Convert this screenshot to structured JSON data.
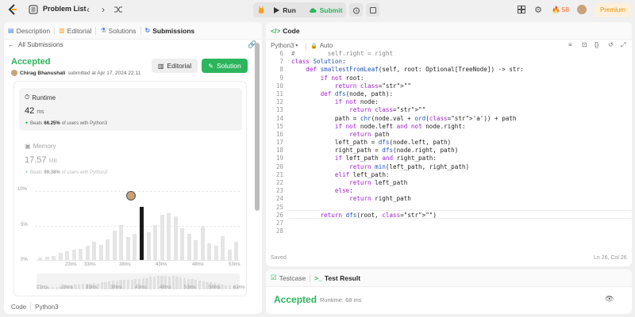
{
  "topbar": {
    "problem_list": "Problem List",
    "run": "Run",
    "submit": "Submit",
    "streak": "58",
    "premium": "Premium"
  },
  "left": {
    "tabs": [
      "Description",
      "Editorial",
      "Solutions",
      "Submissions"
    ],
    "back": "All Submissions",
    "status": "Accepted",
    "user": "Chirag Bhanushali",
    "submitted": "submitted at Apr 17, 2024 22:11",
    "editorial_btn": "Editorial",
    "solution_btn": "Solution",
    "runtime": {
      "title": "Runtime",
      "value": "42",
      "unit": "ms",
      "beats_label": "Beats",
      "beats_pct": "66.25%",
      "beats_suffix": "of users with Python3"
    },
    "memory": {
      "title": "Memory",
      "value": "17.57",
      "unit": "MB",
      "beats_label": "Beats",
      "beats_pct": "99.38%",
      "beats_suffix": "of users with Python3"
    },
    "footer": {
      "code_label": "Code",
      "lang": "Python3"
    }
  },
  "chart_data": {
    "type": "bar",
    "y_ticks": [
      "10%",
      "5%",
      "0%"
    ],
    "x_ticks": [
      "23ms",
      "33ms",
      "38ms",
      "43ms",
      "48ms",
      "53ms"
    ],
    "mini_ticks": [
      "23ms",
      "28ms",
      "33ms",
      "38ms",
      "43ms",
      "48ms",
      "53ms",
      "58ms",
      "63ms"
    ],
    "values": [
      0.3,
      0.4,
      0.6,
      1.0,
      1.3,
      1.5,
      1.6,
      2.0,
      2.6,
      2.2,
      3.0,
      4.2,
      5.0,
      3.3,
      3.8,
      7.6,
      4.0,
      5.0,
      6.5,
      6.7,
      6.2,
      4.5,
      3.7,
      2.8,
      4.8,
      2.4,
      2.0,
      3.4,
      1.5,
      2.6
    ],
    "highlight_index": 15,
    "ylim": [
      0,
      10
    ],
    "mini_values": [
      0.8,
      1,
      1,
      1.2,
      1.4,
      1.4,
      1.6,
      1.6,
      2,
      2.1,
      2.6,
      2.7,
      3,
      3.2,
      3.3,
      3.6,
      3.3,
      3.8,
      4,
      4.6,
      4.8,
      5.1,
      5.4,
      5.5,
      5.3,
      5.5,
      5.8,
      6,
      6.4,
      6.2,
      7,
      7,
      7.6,
      7.4,
      7.7,
      7.3,
      7.5,
      7.1,
      6.8,
      6.4,
      6,
      5.6,
      5.2,
      4.8,
      4.4,
      4.2,
      3.8,
      3.5,
      3.2,
      2.8,
      2.4,
      2.1,
      1.8,
      1.5
    ]
  },
  "right": {
    "code_tab": "Code",
    "lang": "Python3",
    "mode": "Auto",
    "lines": [
      {
        "n": "6",
        "t": "#         self.right = right",
        "c": "cm"
      },
      {
        "n": "7",
        "t": "class Solution:",
        "c": "cls"
      },
      {
        "n": "8",
        "t": "    def smallestFromLeaf(self, root: Optional[TreeNode]) -> str:",
        "c": "def"
      },
      {
        "n": "9",
        "t": "        if not root:",
        "c": ""
      },
      {
        "n": "10",
        "t": "            return \"\"",
        "c": ""
      },
      {
        "n": "11",
        "t": "        def dfs(node, path):",
        "c": ""
      },
      {
        "n": "12",
        "t": "            if not node:",
        "c": ""
      },
      {
        "n": "13",
        "t": "                return \"\"",
        "c": ""
      },
      {
        "n": "14",
        "t": "            path = chr(node.val + ord('a')) + path",
        "c": ""
      },
      {
        "n": "15",
        "t": "            if not node.left and not node.right:",
        "c": ""
      },
      {
        "n": "16",
        "t": "                return path",
        "c": ""
      },
      {
        "n": "17",
        "t": "            left_path = dfs(node.left, path)",
        "c": ""
      },
      {
        "n": "18",
        "t": "            right_path = dfs(node.right, path)",
        "c": ""
      },
      {
        "n": "19",
        "t": "            if left_path and right_path:",
        "c": ""
      },
      {
        "n": "20",
        "t": "                return min(left_path, right_path)",
        "c": ""
      },
      {
        "n": "21",
        "t": "            elif left_path:",
        "c": ""
      },
      {
        "n": "22",
        "t": "                return left_path",
        "c": ""
      },
      {
        "n": "23",
        "t": "            else:",
        "c": ""
      },
      {
        "n": "24",
        "t": "                return right_path",
        "c": ""
      },
      {
        "n": "25",
        "t": "",
        "c": ""
      },
      {
        "n": "26",
        "t": "        return dfs(root, \"\")",
        "c": ""
      },
      {
        "n": "27",
        "t": "",
        "c": ""
      },
      {
        "n": "28",
        "t": "",
        "c": ""
      }
    ],
    "saved": "Saved",
    "cursor": "Ln 26, Col 26"
  },
  "bottom": {
    "testcase": "Testcase",
    "result_tab": "Test Result",
    "status": "Accepted",
    "runtime": "Runtime: 68 ms"
  },
  "colors": {
    "accent": "#2db55d",
    "orange": "#ffa116",
    "blue": "#3e7de0"
  }
}
